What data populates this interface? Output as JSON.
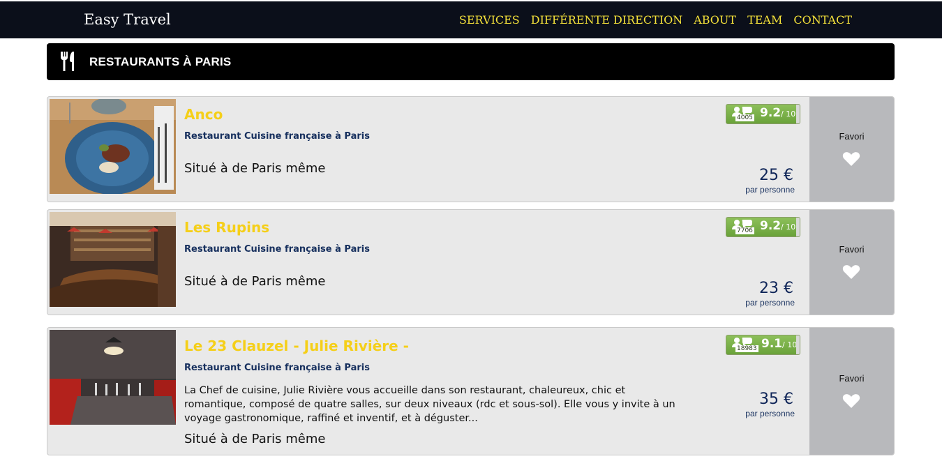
{
  "header": {
    "brand": "Easy Travel",
    "nav": [
      "SERVICES",
      "DIFFÉRENTE DIRECTION",
      "ABOUT",
      "TEAM",
      "CONTACT"
    ]
  },
  "section": {
    "title": "RESTAURANTS À PARIS",
    "icon": "fork-knife-icon"
  },
  "restaurants": [
    {
      "name": "Anco",
      "type": "Restaurant Cuisine française à Paris",
      "description": "",
      "location": "Situé à de Paris même",
      "reviews": "4005",
      "score": "9.2",
      "score_max": "/ 10",
      "price": "25 €",
      "per_person": "par personne",
      "favorite_label": "Favori"
    },
    {
      "name": "Les Rupins",
      "type": "Restaurant Cuisine française à Paris",
      "description": "",
      "location": "Situé à de Paris même",
      "reviews": "7706",
      "score": "9.2",
      "score_max": "/ 10",
      "price": "23 €",
      "per_person": "par personne",
      "favorite_label": "Favori"
    },
    {
      "name": "Le 23 Clauzel - Julie Rivière -",
      "type": "Restaurant Cuisine française à Paris",
      "description": "La Chef de cuisine, Julie Rivière vous accueille dans son restaurant, chaleureux, chic et romantique, composé de quatre salles, sur deux niveaux (rdc et sous-sol). Elle vous y invite à un voyage gastronomique, raffiné et inventif, et à déguster...",
      "location": "Situé à de Paris même",
      "reviews": "18983",
      "score": "9.1",
      "score_max": "/ 10",
      "price": "35 €",
      "per_person": "par personne",
      "favorite_label": "Favori"
    }
  ],
  "colors": {
    "topbar": "#0b0f1a",
    "nav_link": "#f5e23a",
    "restaurant_name": "#f5cf19",
    "rating_green": "#7ab04a",
    "favorite_panel": "#b8b9bc"
  }
}
